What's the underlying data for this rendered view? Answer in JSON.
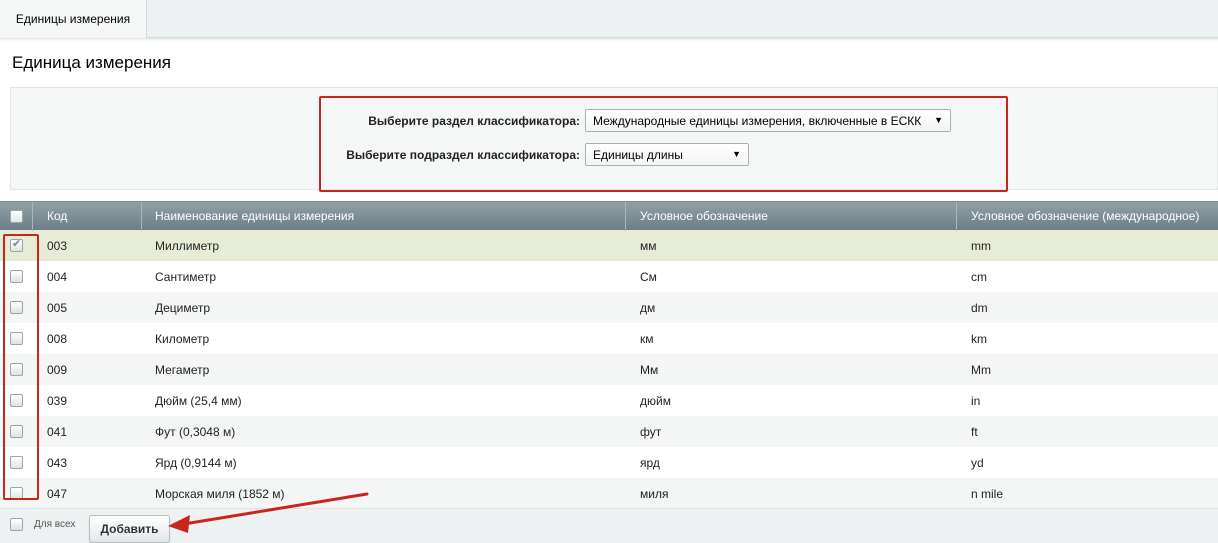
{
  "tab": {
    "label": "Единицы измерения"
  },
  "page": {
    "title": "Единица измерения"
  },
  "filters": {
    "section_label": "Выберите раздел классификатора:",
    "section_value": "Международные единицы измерения, включенные в ЕСКК",
    "subsection_label": "Выберите подраздел классификатора:",
    "subsection_value": "Единицы длины"
  },
  "table": {
    "headers": {
      "code": "Код",
      "name": "Наименование единицы измерения",
      "symbol": "Условное обозначение",
      "intl": "Условное обозначение (международное)"
    },
    "rows": [
      {
        "code": "003",
        "name": "Миллиметр",
        "symbol": "мм",
        "intl": "mm",
        "checked": true
      },
      {
        "code": "004",
        "name": "Сантиметр",
        "symbol": "См",
        "intl": "cm",
        "checked": false
      },
      {
        "code": "005",
        "name": "Дециметр",
        "symbol": "дм",
        "intl": "dm",
        "checked": false
      },
      {
        "code": "008",
        "name": "Километр",
        "symbol": "км",
        "intl": "km",
        "checked": false
      },
      {
        "code": "009",
        "name": "Мегаметр",
        "symbol": "Мм",
        "intl": "Mm",
        "checked": false
      },
      {
        "code": "039",
        "name": "Дюйм (25,4 мм)",
        "symbol": "дюйм",
        "intl": "in",
        "checked": false
      },
      {
        "code": "041",
        "name": "Фут (0,3048 м)",
        "symbol": "фут",
        "intl": "ft",
        "checked": false
      },
      {
        "code": "043",
        "name": "Ярд (0,9144 м)",
        "symbol": "ярд",
        "intl": "yd",
        "checked": false
      },
      {
        "code": "047",
        "name": "Морская миля (1852 м)",
        "symbol": "миля",
        "intl": "n mile",
        "checked": false
      }
    ]
  },
  "footer": {
    "for_all_label": "Для всех",
    "add_button": "Добавить"
  },
  "colors": {
    "annotation_red": "#c8261d",
    "header_bg": "#7d8e94",
    "selected_row": "#e6ecd5"
  }
}
